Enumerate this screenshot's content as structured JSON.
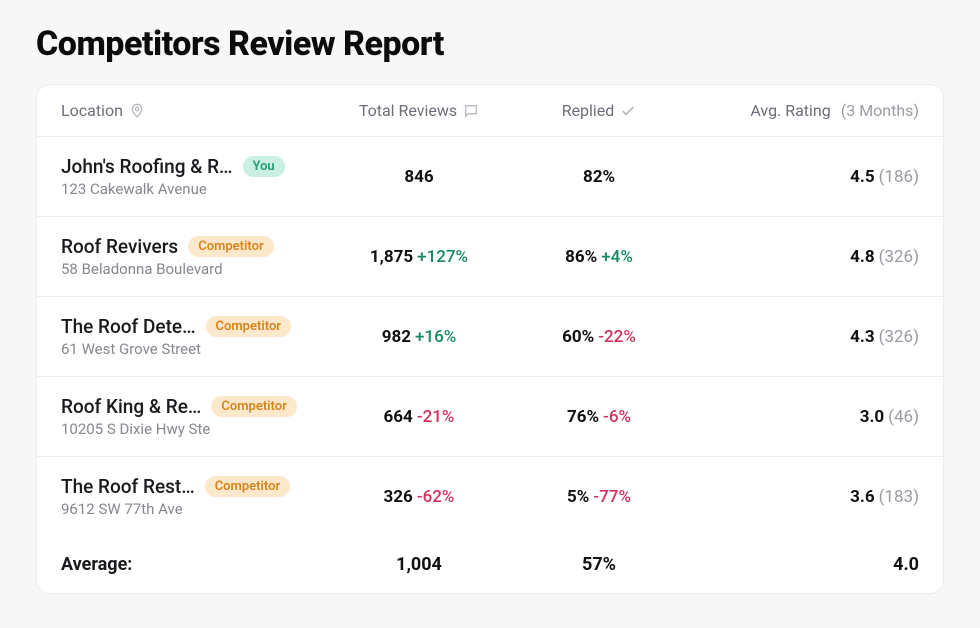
{
  "title": "Competitors Review Report",
  "headers": {
    "location": "Location",
    "total": "Total Reviews",
    "replied": "Replied",
    "rating": "Avg. Rating",
    "rating_suffix": "(3 Months)"
  },
  "badges": {
    "you": "You",
    "competitor": "Competitor"
  },
  "rows": [
    {
      "name": "John's Roofing & R…",
      "badge": "you",
      "address": "123 Cakewalk Avenue",
      "total": "846",
      "total_delta": "",
      "total_delta_sign": "",
      "replied": "82%",
      "replied_delta": "",
      "replied_delta_sign": "",
      "rating": "4.5",
      "rating_count": "(186)"
    },
    {
      "name": "Roof Revivers",
      "badge": "competitor",
      "address": "58 Beladonna Boulevard",
      "total": "1,875",
      "total_delta": "+127%",
      "total_delta_sign": "pos",
      "replied": "86%",
      "replied_delta": "+4%",
      "replied_delta_sign": "pos",
      "rating": "4.8",
      "rating_count": "(326)"
    },
    {
      "name": "The Roof Dete…",
      "badge": "competitor",
      "address": "61 West Grove Street",
      "total": "982",
      "total_delta": "+16%",
      "total_delta_sign": "pos",
      "replied": "60%",
      "replied_delta": "-22%",
      "replied_delta_sign": "neg",
      "rating": "4.3",
      "rating_count": "(326)"
    },
    {
      "name": "Roof King & Re…",
      "badge": "competitor",
      "address": "10205 S Dixie Hwy Ste",
      "total": "664",
      "total_delta": "-21%",
      "total_delta_sign": "neg",
      "replied": "76%",
      "replied_delta": "-6%",
      "replied_delta_sign": "neg",
      "rating": "3.0",
      "rating_count": "(46)"
    },
    {
      "name": "The Roof Rest…",
      "badge": "competitor",
      "address": "9612 SW 77th Ave",
      "total": "326",
      "total_delta": "-62%",
      "total_delta_sign": "neg",
      "replied": "5%",
      "replied_delta": "-77%",
      "replied_delta_sign": "neg",
      "rating": "3.6",
      "rating_count": "(183)"
    }
  ],
  "average": {
    "label": "Average:",
    "total": "1,004",
    "replied": "57%",
    "rating": "4.0"
  }
}
